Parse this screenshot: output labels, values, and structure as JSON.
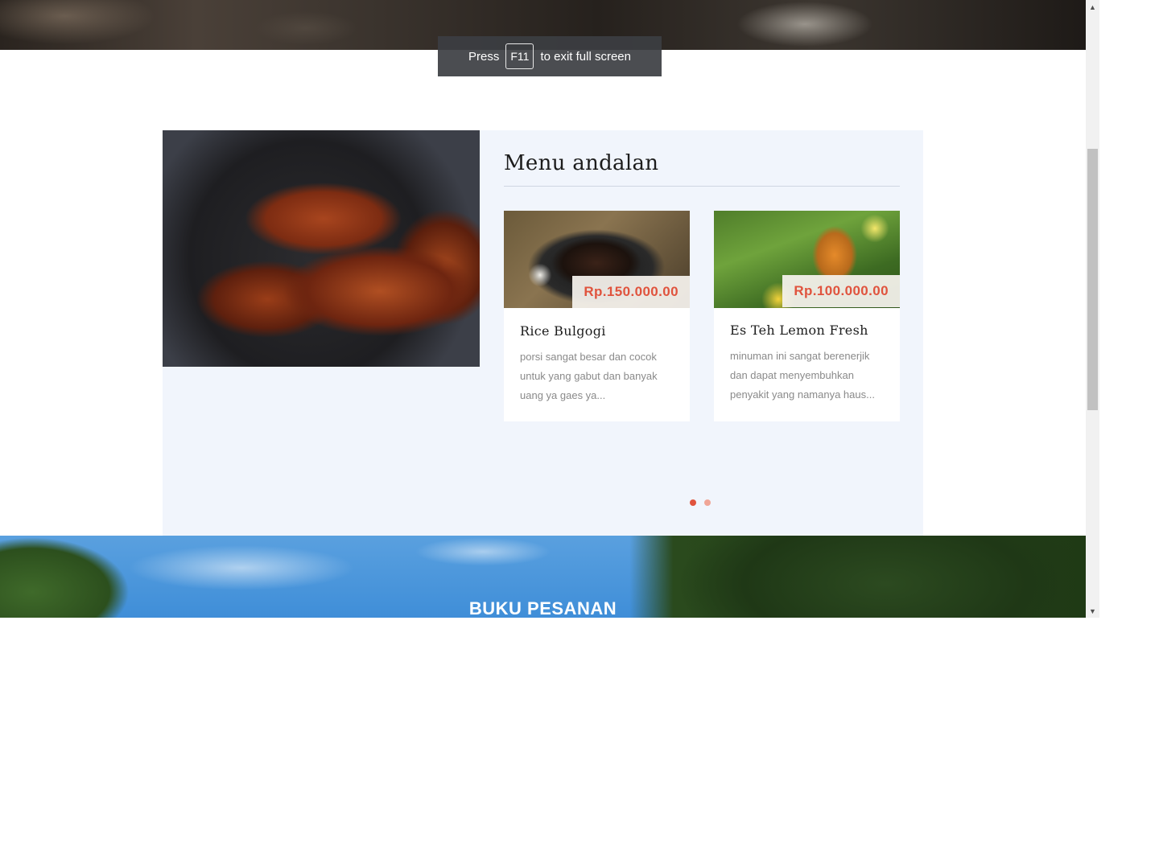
{
  "fullscreen_notice": {
    "prefix": "Press",
    "key": "F11",
    "suffix": "to exit full screen"
  },
  "featured_section": {
    "heading": "Menu andalan",
    "menu_items": [
      {
        "name": "Rice Bulgogi",
        "price": "Rp.150.000.00",
        "description": "porsi sangat besar dan cocok untuk yang gabut dan banyak uang ya gaes ya..."
      },
      {
        "name": "Es Teh Lemon Fresh",
        "price": "Rp.100.000.00",
        "description": "minuman ini sangat berenerjik dan dapat menyembuhkan penyakit yang namanya haus..."
      }
    ],
    "carousel": {
      "page_count": 2,
      "active_page": 1
    }
  },
  "booking_banner": {
    "title": "BUKU PESANAN"
  },
  "colors": {
    "accent": "#e0533d",
    "section_bg": "#f1f5fc"
  },
  "scrollbar": {
    "up_icon": "triangle-up-icon",
    "down_icon": "triangle-down-icon"
  }
}
